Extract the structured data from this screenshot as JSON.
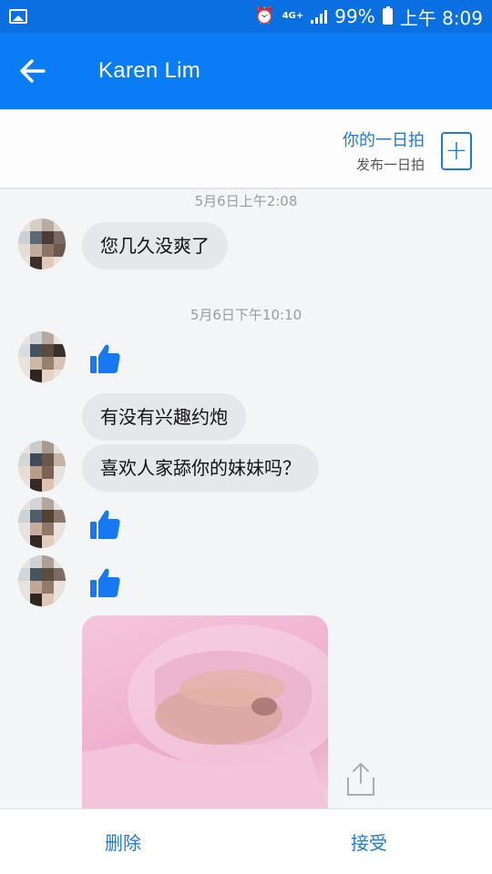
{
  "status_bar": {
    "network": "4G+",
    "battery": "99%",
    "time": "上午 8:09",
    "icons": [
      "gallery-icon",
      "alarm-icon",
      "signal-icon",
      "battery-icon"
    ]
  },
  "header": {
    "title": "Karen Lim",
    "back_icon": "back-arrow-icon"
  },
  "day_banner": {
    "title": "你的一日拍",
    "subtitle": "发布一日拍",
    "add_icon": "plus-icon"
  },
  "messages": {
    "timestamp_1": "5月6日上午2:08",
    "bubble_1": "您几久没爽了",
    "timestamp_2": "5月6日下午10:10",
    "bubble_2": "有没有兴趣约炮",
    "bubble_3": "喜欢人家舔你的妹妹吗？"
  },
  "bottom_bar": {
    "delete_label": "删除",
    "accept_label": "接受"
  },
  "colors": {
    "header": "#0a7cf5",
    "status_bar": "#0a6fe0",
    "accent": "#1e7ae0",
    "bubble": "#e6e7eb",
    "like": "#1877f2"
  }
}
